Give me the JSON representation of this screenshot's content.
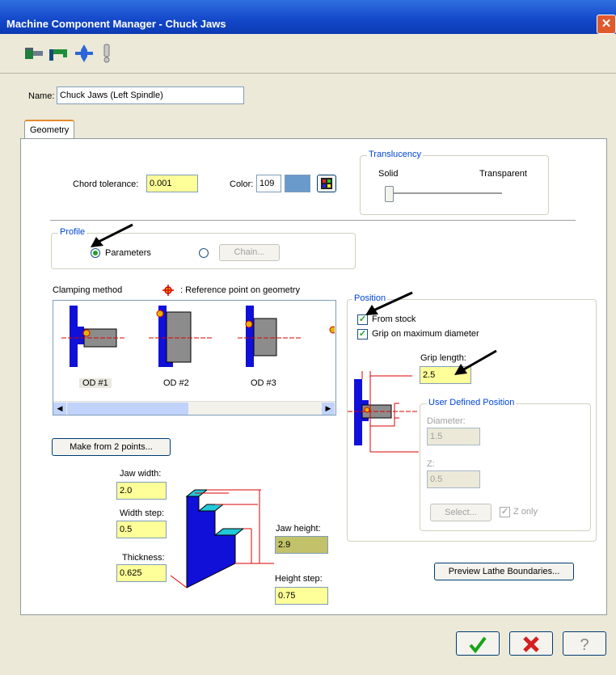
{
  "window": {
    "title": "Machine Component Manager - Chuck Jaws",
    "close_glyph": "✕"
  },
  "toolbar": {
    "icons": [
      "stock-icon",
      "chuck-icon",
      "tailstock-icon",
      "steady-rest-icon"
    ]
  },
  "name": {
    "label": "Name:",
    "value": "Chuck Jaws (Left Spindle)"
  },
  "tabs": [
    {
      "label": "Geometry",
      "active": true
    }
  ],
  "geometry": {
    "chord_tolerance_label": "Chord tolerance:",
    "chord_tolerance_value": "0.001",
    "color_label": "Color:",
    "color_value": "109",
    "color_swatch": "#6a9acb"
  },
  "translucency": {
    "title": "Translucency",
    "left_label": "Solid",
    "right_label": "Transparent",
    "level": 0.0
  },
  "profile": {
    "title": "Profile",
    "options": [
      {
        "label": "Parameters",
        "selected": true
      },
      {
        "label": "",
        "selected": false
      }
    ],
    "chain_button": "Chain..."
  },
  "clamping": {
    "label": "Clamping method",
    "ref_note": ": Reference point on geometry",
    "methods": [
      "OD #1",
      "OD #2",
      "OD #3"
    ],
    "selected": "OD #1"
  },
  "make_from_points_button": "Make from 2 points...",
  "jaw": {
    "width_label": "Jaw width:",
    "width_value": "2.0",
    "width_step_label": "Width step:",
    "width_step_value": "0.5",
    "thickness_label": "Thickness:",
    "thickness_value": "0.625",
    "height_label": "Jaw height:",
    "height_value": "2.9",
    "height_step_label": "Height step:",
    "height_step_value": "0.75"
  },
  "position": {
    "title": "Position",
    "from_stock": {
      "label": "From stock",
      "checked": true
    },
    "grip_max_diameter": {
      "label": "Grip on maximum diameter",
      "checked": true
    },
    "grip_length_label": "Grip length:",
    "grip_length_value": "2.5",
    "user_defined": {
      "title": "User Defined Position",
      "diameter_label": "Diameter:",
      "diameter_value": "1.5",
      "z_label": "Z:",
      "z_value": "0.5",
      "select_button": "Select...",
      "z_only_label": "Z only",
      "z_only_checked": true
    }
  },
  "preview_button": "Preview Lathe Boundaries...",
  "footer": {
    "ok_icon": "checkmark-icon",
    "cancel_icon": "red-x-icon",
    "help_icon": "help-icon"
  }
}
